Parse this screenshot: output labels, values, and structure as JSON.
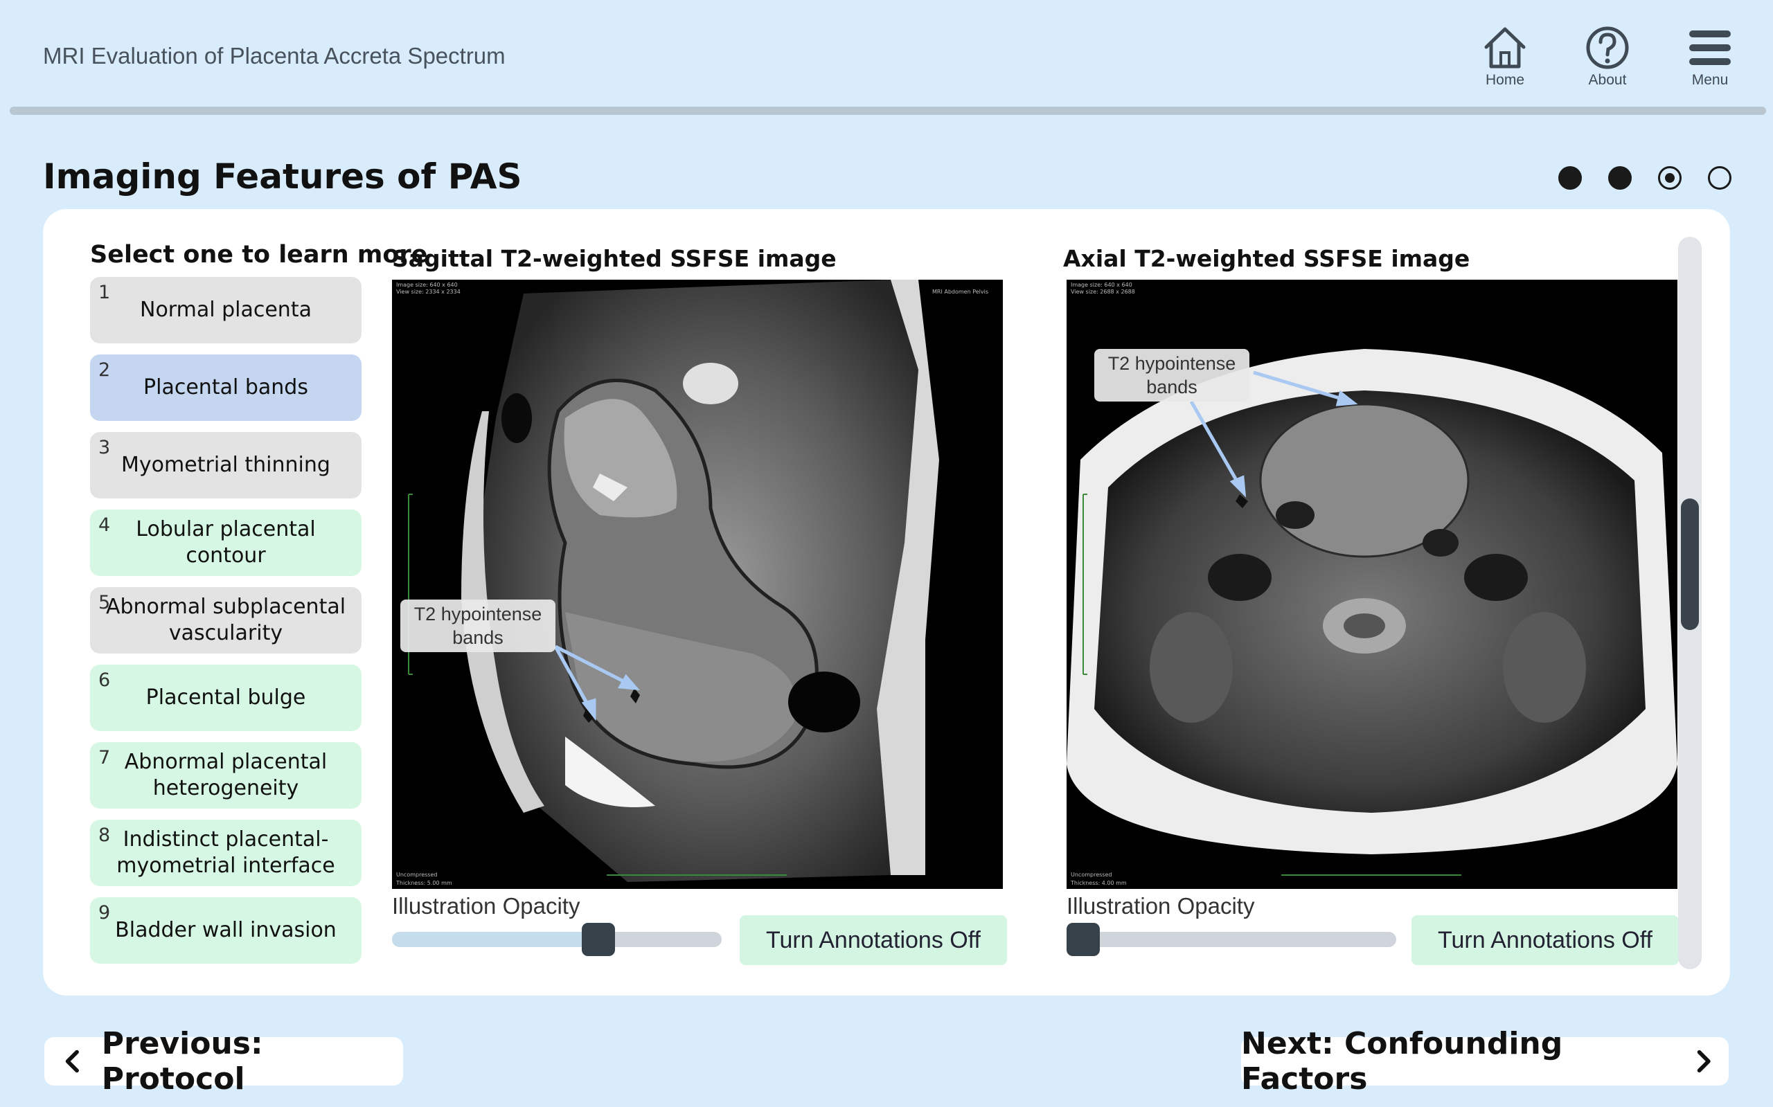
{
  "header": {
    "title": "MRI Evaluation of Placenta Accreta Spectrum",
    "nav": [
      {
        "label": "Home",
        "icon": "home-icon"
      },
      {
        "label": "About",
        "icon": "help-icon"
      },
      {
        "label": "Menu",
        "icon": "hamburger-menu-icon"
      }
    ]
  },
  "section": {
    "title": "Imaging Features of PAS",
    "pager": {
      "total": 4,
      "current": 3
    }
  },
  "features": {
    "title": "Select one to learn more",
    "items": [
      {
        "num": "1",
        "label": "Normal placenta",
        "state": "grey"
      },
      {
        "num": "2",
        "label": "Placental bands",
        "state": "blue"
      },
      {
        "num": "3",
        "label": "Myometrial thinning",
        "state": "grey"
      },
      {
        "num": "4",
        "label": "Lobular placental contour",
        "state": "green"
      },
      {
        "num": "5",
        "label": "Abnormal subplacental vascularity",
        "state": "grey"
      },
      {
        "num": "6",
        "label": "Placental bulge",
        "state": "green"
      },
      {
        "num": "7",
        "label": "Abnormal placental heterogeneity",
        "state": "green"
      },
      {
        "num": "8",
        "label": "Indistinct placental-myometrial interface",
        "state": "green"
      },
      {
        "num": "9",
        "label": "Bladder wall invasion",
        "state": "green"
      }
    ]
  },
  "sagittal": {
    "title": "Sagittal T2-weighted SSFSE image",
    "callout_line1": "T2 hypointense",
    "callout_line2": "bands",
    "opacity_label": "Illustration Opacity",
    "opacity_value": 0.64,
    "toggle_label": "Turn Annotations Off"
  },
  "axial": {
    "title": "Axial T2-weighted SSFSE image",
    "callout_line1": "T2 hypointense",
    "callout_line2": "bands",
    "opacity_label": "Illustration Opacity",
    "opacity_value": 0.0,
    "toggle_label": "Turn Annotations Off"
  },
  "footer": {
    "prev_label": "Previous: Protocol",
    "next_label": "Next: Confounding Factors"
  },
  "colors": {
    "background": "#d8ecfb",
    "selected_item": "#c5d6f0",
    "visited_item": "#e3e3e3",
    "unvisited_item": "#d6f7e4",
    "annotation_arrow": "#a9c9f2"
  }
}
